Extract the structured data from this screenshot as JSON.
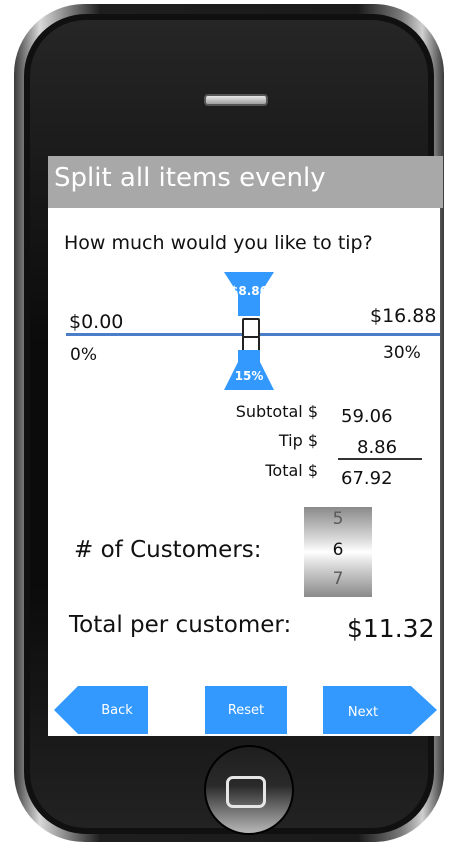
{
  "screen": {
    "title": "Split all items evenly",
    "question": "How much would you like to tip?"
  },
  "slider": {
    "min_amount": "$0.00",
    "max_amount": "$16.88",
    "min_percent": "0%",
    "max_percent": "30%",
    "tip_amount": "$8.86",
    "tip_percent": "15%",
    "level_fraction": 0.5
  },
  "totals": {
    "subtotal_label": "Subtotal $",
    "subtotal_value": "59.06",
    "tip_label": "Tip $",
    "tip_value": "8.86",
    "total_label": "Total $",
    "total_value": "67.92"
  },
  "customers": {
    "label": "# of Customers:",
    "options": [
      "5",
      "6",
      "7"
    ],
    "selected": "6"
  },
  "per_customer": {
    "label": "Total per customer:",
    "value": "$11.32"
  },
  "buttons": {
    "back": "Back",
    "reset": "Reset",
    "next": "Next"
  },
  "colors": {
    "accent": "#3399ff",
    "title_bar": "#a8a8a8",
    "slider_line": "#4a7fc8"
  },
  "icons": {
    "home_button": "home-square-icon",
    "speaker": "speaker-slot"
  }
}
